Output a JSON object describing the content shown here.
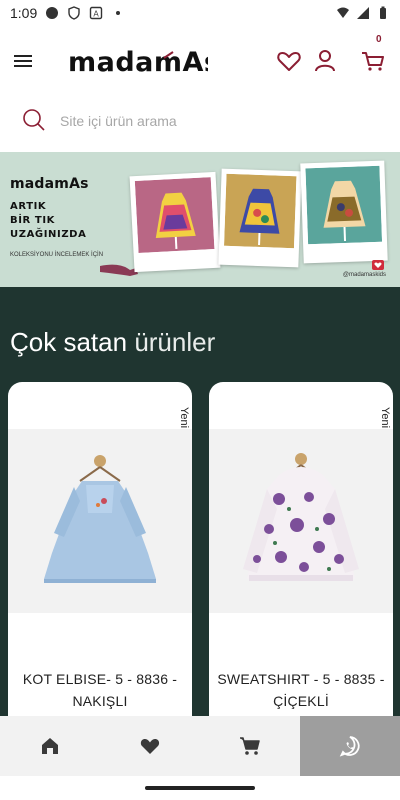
{
  "status_bar": {
    "time": "1:09"
  },
  "header": {
    "logo_text": "madamAs",
    "cart_count": "0"
  },
  "search": {
    "placeholder": "Site içi ürün arama"
  },
  "banner": {
    "logo": "madamAs",
    "tagline_line1": "ARTIK",
    "tagline_line2": "BİR TIK",
    "tagline_line3": "UZAĞINIZDA",
    "cta": "KOLEKSİYONU İNCELEMEK İÇİN",
    "handle": "@madamaskids"
  },
  "best_sellers": {
    "title_bold": "Çok satan",
    "title_light": "ürünler",
    "products": [
      {
        "badge": "Yeni",
        "name": "KOT ELBISE- 5 - 8836 - NAKIŞLI"
      },
      {
        "badge": "Yeni",
        "name": "SWEATSHIRT - 5 - 8835 - ÇİÇEKLİ"
      }
    ]
  },
  "bottom_nav": {
    "items": [
      {
        "icon": "home-icon"
      },
      {
        "icon": "heart-icon"
      },
      {
        "icon": "cart-icon"
      },
      {
        "icon": "whatsapp-icon"
      }
    ]
  },
  "colors": {
    "brand_accent": "#8b1e33",
    "section_bg": "#1f3530",
    "banner_bg": "#c9ddd2",
    "nav_active": "#9e9e9e"
  }
}
